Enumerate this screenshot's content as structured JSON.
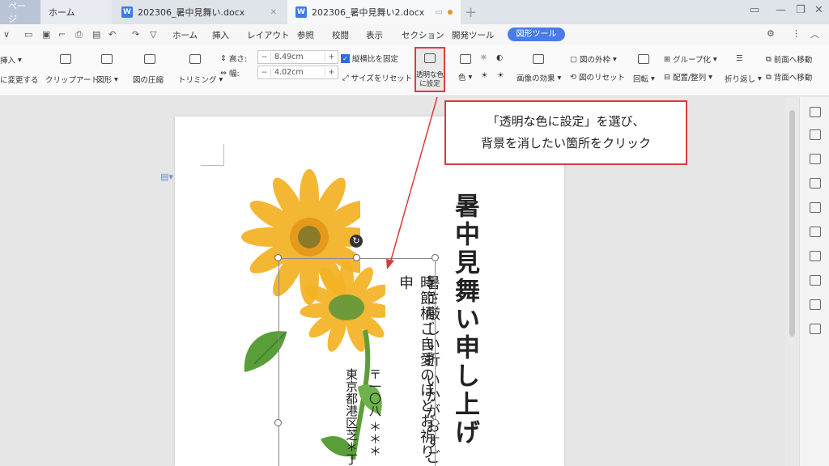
{
  "tabs": {
    "first": "ページ",
    "home": "ホーム",
    "doc1": "202306_暑中見舞い.docx",
    "doc2": "202306_暑中見舞い2.docx"
  },
  "menu": {
    "items": [
      "ホーム",
      "挿入",
      "レイアウト",
      "参照",
      "校閲",
      "表示",
      "セクション",
      "開発ツール"
    ],
    "active": "図形ツール"
  },
  "ribbon": {
    "insert": "挿入",
    "convert": "に変更する",
    "clipart": "クリップアート",
    "shape": "図形",
    "compress": "図の圧縮",
    "trim": "トリミング",
    "height_label": "高さ:",
    "height_value": "8.49cm",
    "width_label": "幅:",
    "width_value": "4.02cm",
    "lock_ratio": "縦横比を固定",
    "reset_size": "サイズをリセット",
    "transparent_line1": "透明な色",
    "transparent_line2": "に設定",
    "color": "色",
    "image_effects": "画像の効果",
    "picture_border": "図の外枠",
    "picture_reset": "図のリセット",
    "rotate": "回転",
    "group": "グループ化",
    "align": "配置/整列",
    "wrap": "折り返し",
    "bring_forward": "前面へ移動",
    "send_backward": "背面へ移動"
  },
  "document": {
    "title": "暑中見舞い申し上げ",
    "line1": "暑さ厳しい折 いかがおすご",
    "line2": "時節柄ご自愛のほどお祈り申",
    "line3": "〒一〇八 ＊＊＊",
    "line4": "東京都港区芝＊丁"
  },
  "callout": {
    "line1": "「透明な色に設定」を選び、",
    "line2": "背景を消したい箇所をクリック"
  },
  "colors": {
    "accent": "#4a7ce8",
    "highlight": "#e03d3d",
    "sunflower": "#f2b01e"
  }
}
